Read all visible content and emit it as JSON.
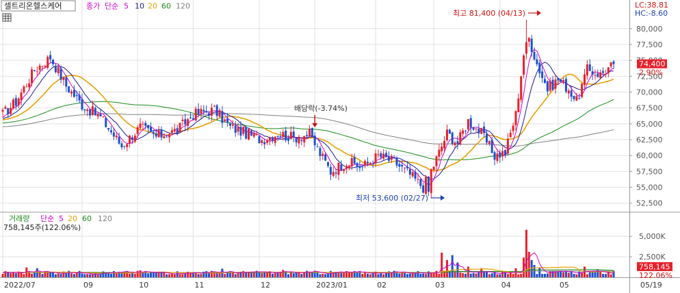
{
  "header": {
    "stock_name": "셀트리온헬스케어",
    "price_type": "종가",
    "ma_type": "단순",
    "ma_periods": [
      "5",
      "10",
      "20",
      "60",
      "120"
    ],
    "ma_colors": [
      "#cc00cc",
      "#1a1a8c",
      "#e6a000",
      "#1a8c1a",
      "#808080"
    ]
  },
  "volume_header": {
    "label": "거래량",
    "ma_type": "단순",
    "ma_periods": [
      "5",
      "20",
      "60",
      "120"
    ],
    "ma_colors": [
      "#cc00cc",
      "#e6a000",
      "#1a8c1a",
      "#808080"
    ],
    "last_volume_text": "758,145주(122.06%)"
  },
  "right_info": {
    "lc": "LC:38.81",
    "hc": "HC:-8.60",
    "last_price": "74,400",
    "change_pct": "2.90%",
    "last_volume": "758,145",
    "volume_pct": "122.06%"
  },
  "annotations": {
    "high": "최고 81,400 (04/13)",
    "low": "최저 53,600 (02/27)",
    "dividend": "배당락(-3.74%)"
  },
  "colors": {
    "up": "#e8202a",
    "down": "#1a4fd0",
    "grid": "#e2e2e2",
    "price_badge": "#e8202a"
  },
  "chart_data": {
    "type": "candlestick",
    "price_axis": {
      "ylim": [
        51500,
        83000
      ],
      "ticks": [
        "52,500",
        "55,000",
        "57,500",
        "60,000",
        "62,500",
        "65,000",
        "67,500",
        "70,000",
        "72,500",
        "75,000",
        "77,500",
        "80,000"
      ]
    },
    "volume_axis": {
      "ticks": [
        "5,000K",
        "2,500K"
      ]
    },
    "x_labels": [
      "2022/07",
      "09",
      "10",
      "11",
      "12",
      "2023/01",
      "02",
      "03",
      "04",
      "05",
      "05/19"
    ],
    "price_anchors": [
      {
        "i": 0,
        "v": 66500
      },
      {
        "i": 5,
        "v": 68500
      },
      {
        "i": 12,
        "v": 73500
      },
      {
        "i": 18,
        "v": 75500
      },
      {
        "i": 24,
        "v": 71000
      },
      {
        "i": 30,
        "v": 68000
      },
      {
        "i": 37,
        "v": 66000
      },
      {
        "i": 45,
        "v": 61500
      },
      {
        "i": 52,
        "v": 64500
      },
      {
        "i": 58,
        "v": 63000
      },
      {
        "i": 66,
        "v": 64000
      },
      {
        "i": 72,
        "v": 66500
      },
      {
        "i": 80,
        "v": 67200
      },
      {
        "i": 86,
        "v": 64500
      },
      {
        "i": 92,
        "v": 63500
      },
      {
        "i": 98,
        "v": 62500
      },
      {
        "i": 104,
        "v": 63500
      },
      {
        "i": 110,
        "v": 62800
      },
      {
        "i": 116,
        "v": 63400
      },
      {
        "i": 119,
        "v": 61000
      },
      {
        "i": 124,
        "v": 57500
      },
      {
        "i": 130,
        "v": 59000
      },
      {
        "i": 136,
        "v": 58200
      },
      {
        "i": 142,
        "v": 60000
      },
      {
        "i": 148,
        "v": 59000
      },
      {
        "i": 154,
        "v": 57000
      },
      {
        "i": 159,
        "v": 55000
      },
      {
        "i": 163,
        "v": 58500
      },
      {
        "i": 168,
        "v": 63500
      },
      {
        "i": 172,
        "v": 62000
      },
      {
        "i": 176,
        "v": 65500
      },
      {
        "i": 181,
        "v": 63500
      },
      {
        "i": 186,
        "v": 60000
      },
      {
        "i": 190,
        "v": 60500
      },
      {
        "i": 194,
        "v": 66500
      },
      {
        "i": 197,
        "v": 76000
      },
      {
        "i": 199,
        "v": 78500
      },
      {
        "i": 202,
        "v": 74500
      },
      {
        "i": 206,
        "v": 70500
      },
      {
        "i": 210,
        "v": 72000
      },
      {
        "i": 214,
        "v": 70500
      },
      {
        "i": 217,
        "v": 68500
      },
      {
        "i": 221,
        "v": 73500
      },
      {
        "i": 226,
        "v": 72800
      },
      {
        "i": 231,
        "v": 74400
      }
    ],
    "high": {
      "i": 198,
      "value": 81400,
      "date": "04/13"
    },
    "low": {
      "i": 161,
      "value": 53600,
      "date": "02/27"
    },
    "dividend_index": 118,
    "volume_spikes": [
      {
        "i": 9,
        "v": 1200
      },
      {
        "i": 13,
        "v": 1100
      },
      {
        "i": 52,
        "v": 850
      },
      {
        "i": 83,
        "v": 1050
      },
      {
        "i": 106,
        "v": 900
      },
      {
        "i": 166,
        "v": 3000
      },
      {
        "i": 168,
        "v": 2100
      },
      {
        "i": 170,
        "v": 2700
      },
      {
        "i": 172,
        "v": 1800
      },
      {
        "i": 176,
        "v": 1300
      },
      {
        "i": 181,
        "v": 1100
      },
      {
        "i": 194,
        "v": 1100
      },
      {
        "i": 197,
        "v": 2400
      },
      {
        "i": 198,
        "v": 5800
      },
      {
        "i": 199,
        "v": 3100
      },
      {
        "i": 200,
        "v": 2100
      },
      {
        "i": 201,
        "v": 1500
      },
      {
        "i": 203,
        "v": 1200
      },
      {
        "i": 220,
        "v": 1300
      },
      {
        "i": 225,
        "v": 900
      }
    ]
  }
}
